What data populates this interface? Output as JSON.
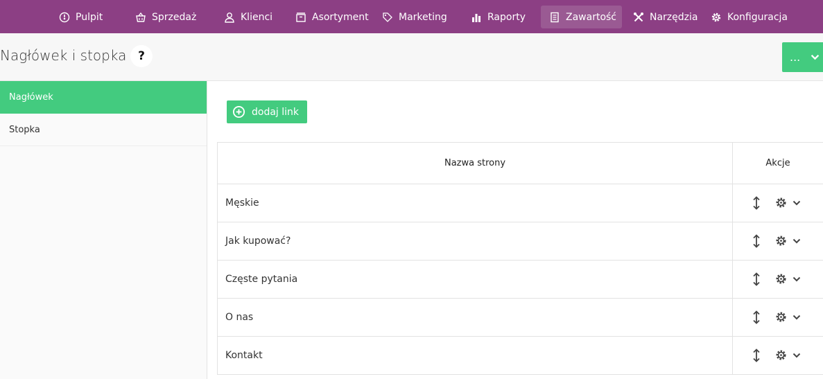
{
  "nav": {
    "items": [
      {
        "label": "Pulpit",
        "icon": "dashboard-icon"
      },
      {
        "label": "Sprzedaż",
        "icon": "basket-icon"
      },
      {
        "label": "Klienci",
        "icon": "user-icon"
      },
      {
        "label": "Asortyment",
        "icon": "box-icon"
      },
      {
        "label": "Marketing",
        "icon": "tag-icon"
      },
      {
        "label": "Raporty",
        "icon": "bar-chart-icon"
      },
      {
        "label": "Zawartość",
        "icon": "document-icon"
      },
      {
        "label": "Narzędzia",
        "icon": "tools-icon"
      },
      {
        "label": "Konfiguracja",
        "icon": "gear-icon"
      }
    ],
    "active": "Zawartość"
  },
  "header": {
    "title": "Nagłówek i stopka",
    "help_label": "?",
    "more_label": "..."
  },
  "sidebar": {
    "items": [
      {
        "label": "Nagłówek",
        "active": true
      },
      {
        "label": "Stopka",
        "active": false
      }
    ]
  },
  "content": {
    "add_button_label": "dodaj link",
    "table": {
      "columns": [
        "Nazwa strony",
        "Akcje"
      ],
      "rows": [
        {
          "name": "Męskie"
        },
        {
          "name": "Jak kupować?"
        },
        {
          "name": "Częste pytania"
        },
        {
          "name": "O nas"
        },
        {
          "name": "Kontakt"
        }
      ]
    }
  },
  "colors": {
    "nav_bg": "#8c3f84",
    "accent_green": "#43cb7f"
  }
}
